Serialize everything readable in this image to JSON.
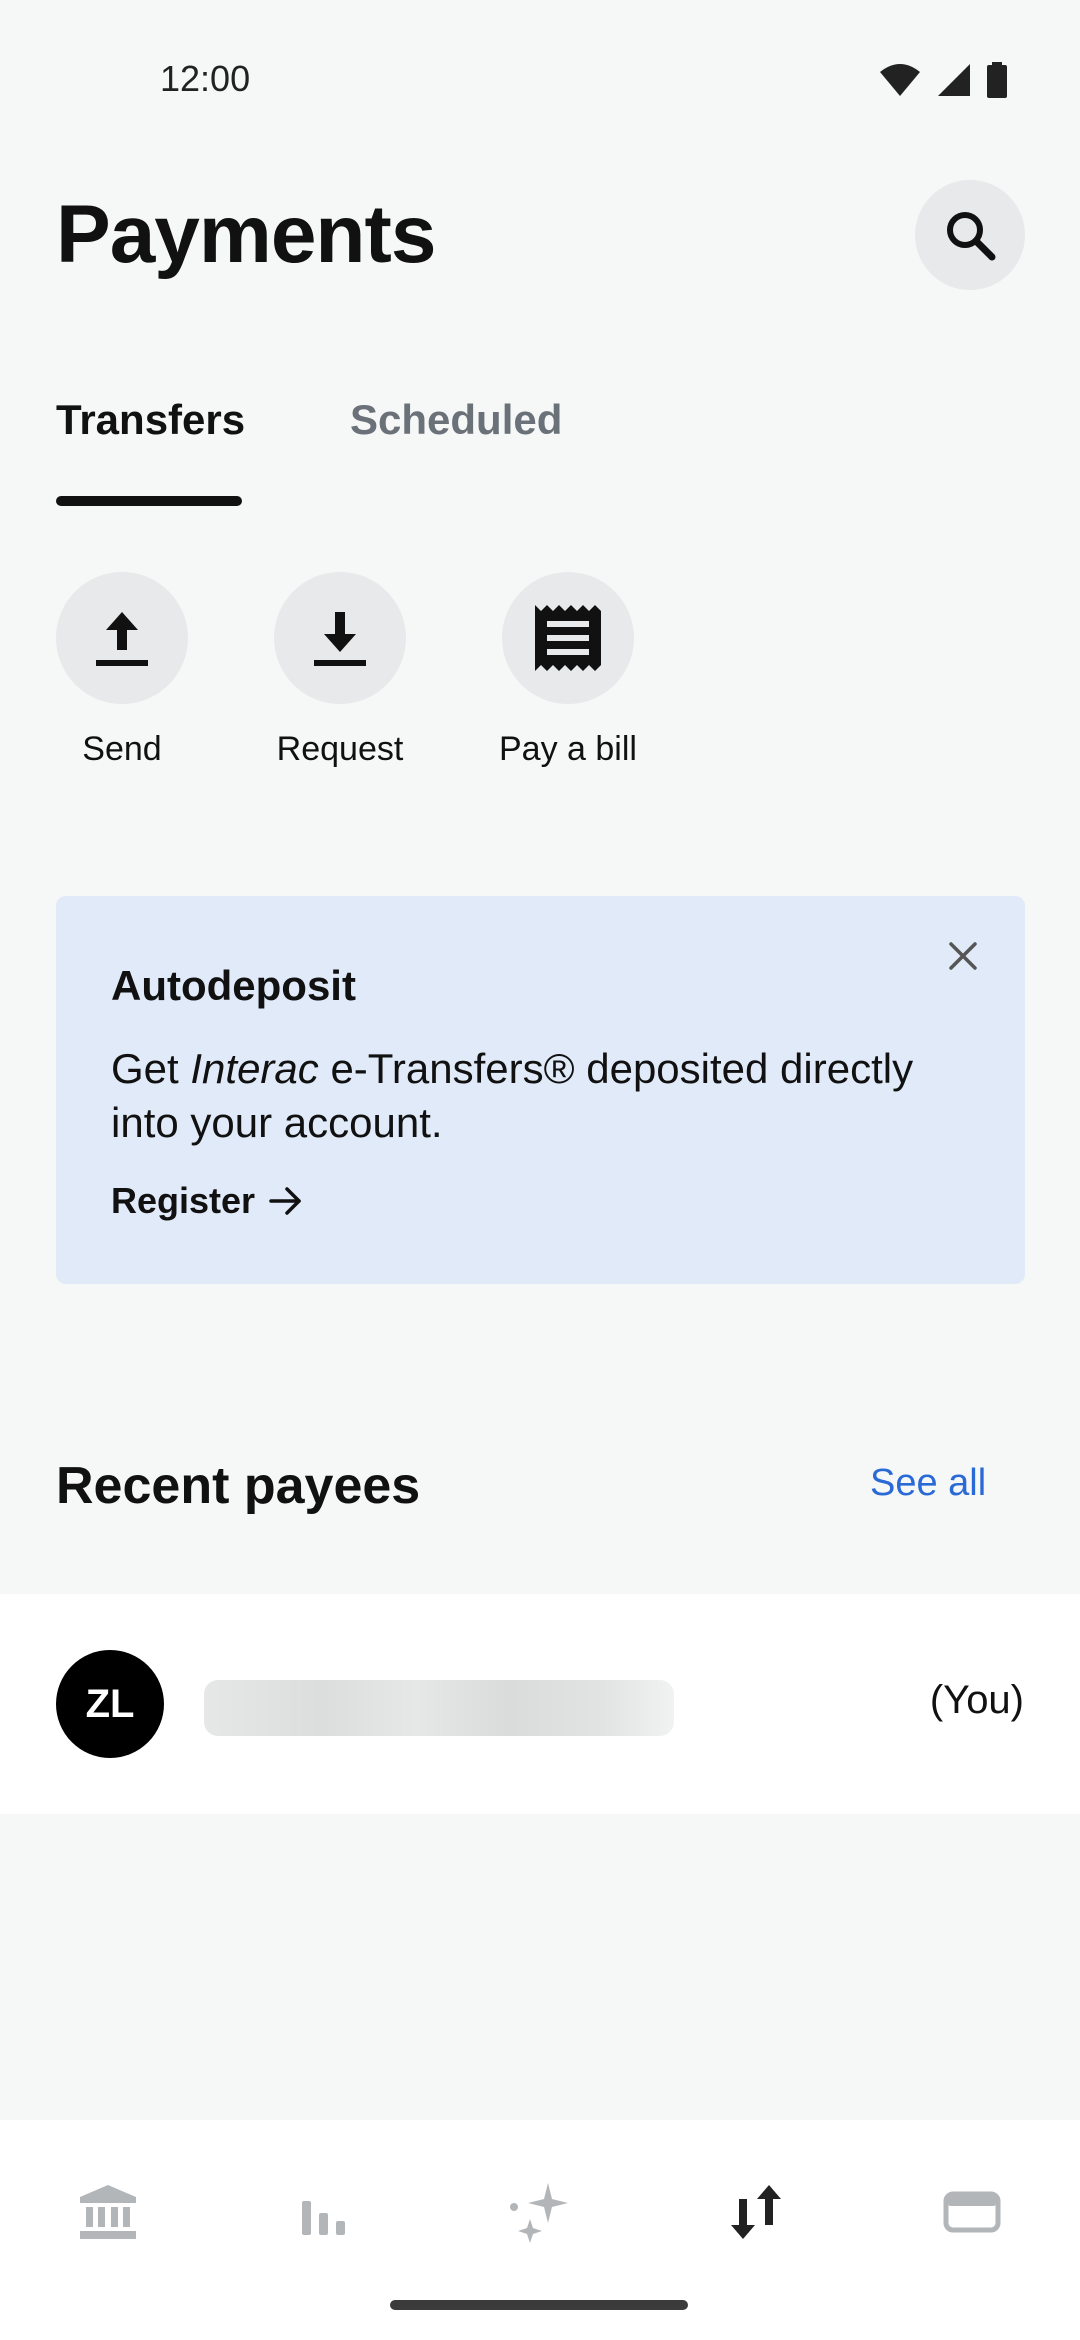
{
  "status_bar": {
    "time": "12:00"
  },
  "header": {
    "title": "Payments"
  },
  "tabs": [
    {
      "label": "Transfers",
      "selected": true
    },
    {
      "label": "Scheduled",
      "selected": false
    }
  ],
  "actions": [
    {
      "label": "Send",
      "icon": "upload-icon"
    },
    {
      "label": "Request",
      "icon": "download-icon"
    },
    {
      "label": "Pay a bill",
      "icon": "receipt-icon"
    }
  ],
  "promo": {
    "title": "Autodeposit",
    "body_prefix": "Get ",
    "body_brand": "Interac",
    "body_suffix": " e-Transfers® deposited directly into your account.",
    "link": "Register"
  },
  "recent_payees": {
    "title": "Recent payees",
    "see_all": "See all",
    "items": [
      {
        "initials": "ZL",
        "note": "(You)"
      }
    ]
  },
  "colors": {
    "accent": "#2a6ad6",
    "promo_bg": "#e1eaf8",
    "background": "#f6f7f7"
  }
}
